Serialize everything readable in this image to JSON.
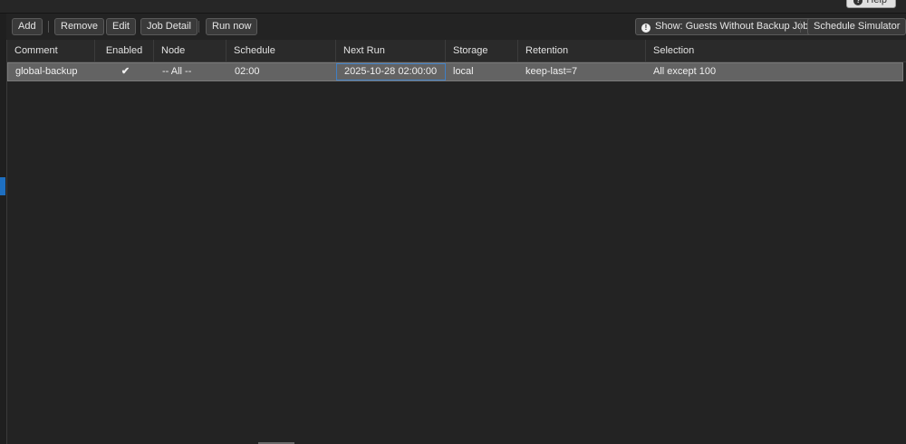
{
  "help_button": {
    "label": "Help",
    "icon": "question-icon"
  },
  "toolbar": {
    "add": "Add",
    "remove": "Remove",
    "edit": "Edit",
    "job_detail": "Job Detail",
    "run_now": "Run now",
    "show_guests": "Show: Guests Without Backup Job",
    "show_guests_icon": "warning-icon",
    "schedule_simulator": "Schedule Simulator"
  },
  "grid": {
    "columns": [
      "Comment",
      "Enabled",
      "Node",
      "Schedule",
      "Next Run",
      "Storage",
      "Retention",
      "Selection"
    ],
    "rows": [
      {
        "comment": "global-backup",
        "enabled": "✔",
        "node": "-- All --",
        "schedule": "02:00",
        "next_run": "2025-10-28 02:00:00",
        "storage": "local",
        "retention": "keep-last=7",
        "selection": "All except 100"
      }
    ]
  },
  "colors": {
    "background": "#232323",
    "selected_row": "#636363",
    "focus_border": "#3f7fc4",
    "edge_marker": "#1e6fc0"
  }
}
